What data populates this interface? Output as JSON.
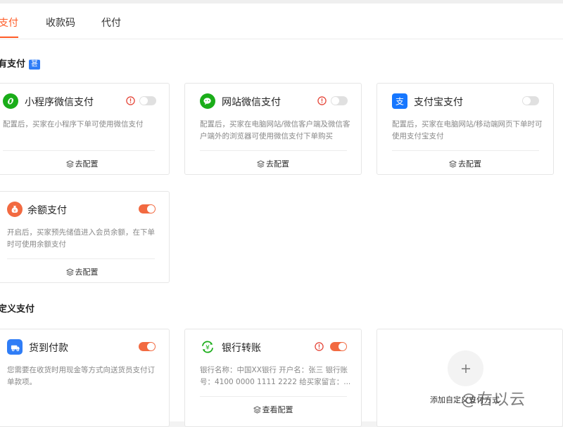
{
  "tabs": [
    {
      "label": "支付",
      "active": true
    },
    {
      "label": "收款码",
      "active": false
    },
    {
      "label": "代付",
      "active": false
    }
  ],
  "sections": {
    "builtin": {
      "title": "有支付",
      "badge": "甚"
    },
    "custom": {
      "title": "定义支付"
    }
  },
  "cards": {
    "mini_wechat": {
      "title": "小程序微信支付",
      "desc": "配置后，买家在小程序下单可使用微信支付",
      "action": "去配置",
      "enabled": false,
      "warning": true,
      "icon": "mini-program-link-icon"
    },
    "web_wechat": {
      "title": "网站微信支付",
      "desc": "配置后，买家在电脑网站/微信客户端及微信客户端外的浏览器可使用微信支付下单购买",
      "action": "去配置",
      "enabled": false,
      "warning": true,
      "icon": "wechat-icon"
    },
    "alipay": {
      "title": "支付宝支付",
      "desc": "配置后，买家在电脑网站/移动端网页下单时可使用支付宝支付",
      "action": "去配置",
      "enabled": false,
      "warning": false,
      "icon": "alipay-icon"
    },
    "balance": {
      "title": "余额支付",
      "desc": "开启后，买家预先储值进入会员余额，在下单时可使用余额支付",
      "action": "去配置",
      "enabled": true,
      "warning": false,
      "icon": "money-bag-icon"
    },
    "cod": {
      "title": "货到付款",
      "desc": "您需要在收货时用现金等方式向送货员支付订单款项。",
      "action": "",
      "enabled": true,
      "warning": false,
      "icon": "delivery-icon"
    },
    "bank": {
      "title": "银行转账",
      "desc": "银行名称：中国XX银行 开户名：张三 银行账号：4100 0000 1111 2222 给买家留言：...",
      "action": "查看配置",
      "enabled": true,
      "warning": true,
      "icon": "bank-transfer-icon"
    }
  },
  "add_card": {
    "label": "添加自定义支付方式"
  },
  "watermark": "@右以云",
  "colors": {
    "accent": "#ff5b26",
    "toggle_on": "#f26a41",
    "warning": "#e5483b",
    "badge": "#2f7df6",
    "wechat": "#1aad19",
    "alipay": "#1677ff"
  }
}
